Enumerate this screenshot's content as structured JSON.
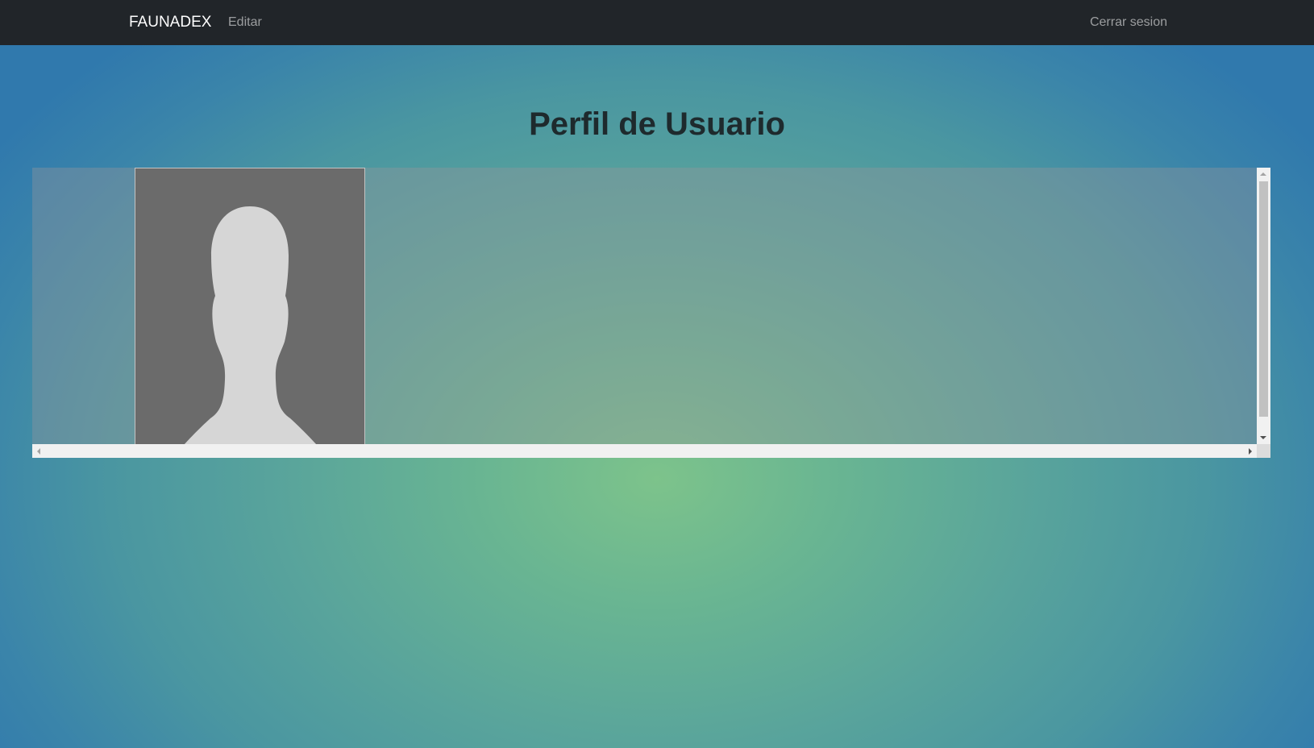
{
  "navbar": {
    "brand": "FAUNADEX",
    "edit_label": "Editar",
    "logout_label": "Cerrar sesion"
  },
  "page": {
    "title": "Perfil de Usuario"
  },
  "profile": {
    "avatar_icon": "person-silhouette-icon"
  },
  "colors": {
    "navbar_bg": "#212529",
    "avatar_bg": "#6b6b6b",
    "silhouette": "#d6d6d6"
  }
}
